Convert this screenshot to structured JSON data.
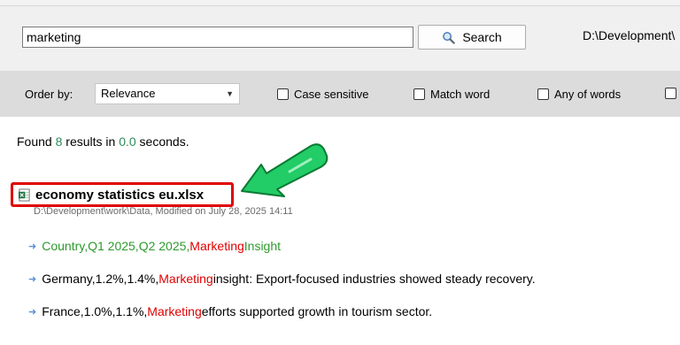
{
  "search": {
    "query": "marketing",
    "button_label": "Search",
    "path": "D:\\Development\\"
  },
  "options": {
    "order_label": "Order by:",
    "order_value": "Relevance",
    "case_sensitive": "Case sensitive",
    "match_word": "Match word",
    "any_of_words": "Any of words"
  },
  "results": {
    "found_prefix": "Found ",
    "count": "8",
    "found_mid": " results in ",
    "time": "0.0",
    "found_suffix": " seconds.",
    "file": {
      "title": "economy statistics eu.xlsx",
      "meta": "D:\\Development\\work\\Data, Modified on July 28, 2025 14:11"
    },
    "lines": [
      {
        "before": "Country,Q1 2025,Q2 2025,",
        "match": "Marketing",
        "after": " Insight"
      },
      {
        "before": "Germany,1.2%,1.4%,",
        "match": "Marketing",
        "after": " insight: Export-focused industries showed steady recovery."
      },
      {
        "before": "France,1.0%,1.1%,",
        "match": "Marketing",
        "after": " efforts supported growth in tourism sector."
      }
    ]
  },
  "colors": {
    "highlight": "#e00000",
    "count": "#2e8b57",
    "annotation_arrow": "#22cc66"
  }
}
